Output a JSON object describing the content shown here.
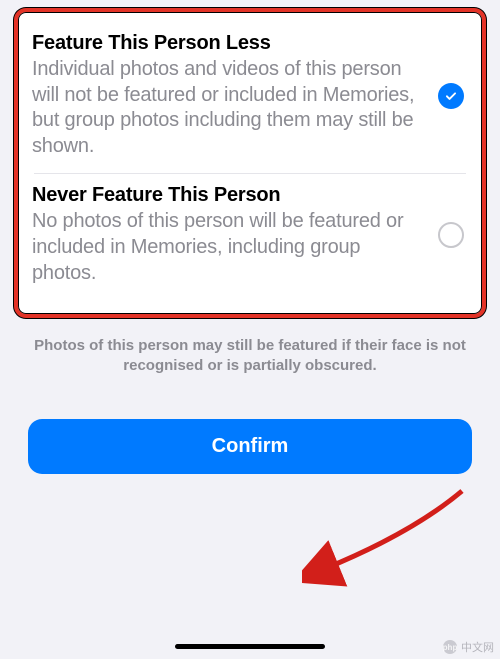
{
  "options": {
    "lessOption": {
      "title": "Feature This Person Less",
      "description": "Individual photos and videos of this person will not be featured or included in Memories, but group photos including them may still be shown.",
      "selected": true
    },
    "neverOption": {
      "title": "Never Feature This Person",
      "description": "No photos of this person will be featured or included in Memories, including group photos.",
      "selected": false
    }
  },
  "footerNote": "Photos of this person may still be featured if their face is not recognised or is partially obscured.",
  "confirmLabel": "Confirm",
  "watermark": "中文网",
  "watermarkLogo": "php"
}
